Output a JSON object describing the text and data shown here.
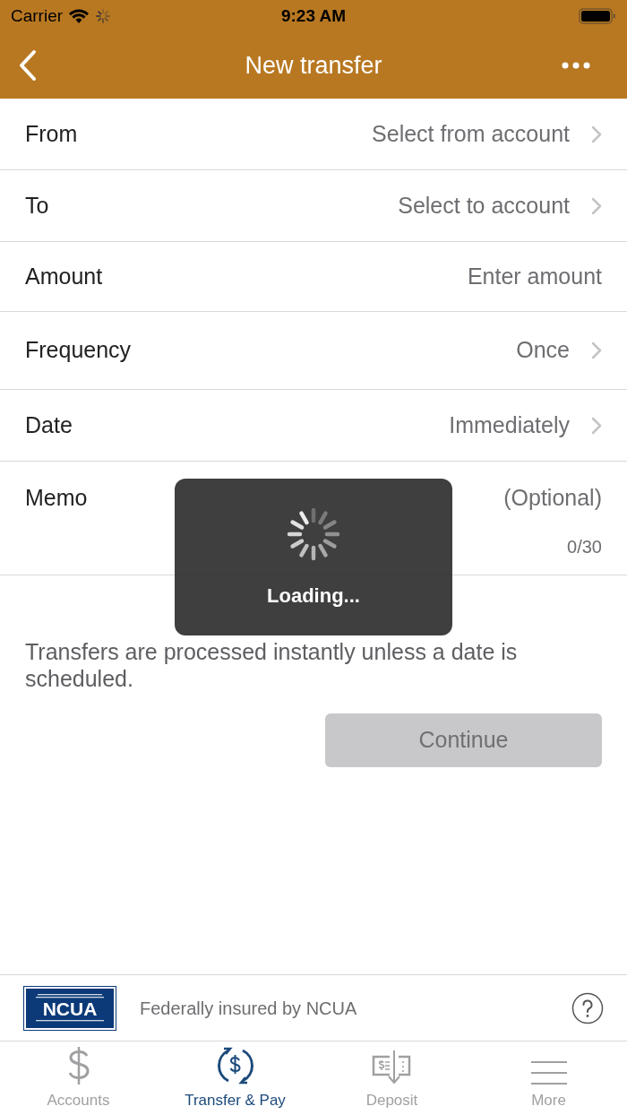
{
  "status_bar": {
    "carrier": "Carrier",
    "time": "9:23 AM"
  },
  "nav": {
    "title": "New transfer"
  },
  "form": [
    {
      "kind": "select",
      "label": "From",
      "value": "Select from account"
    },
    {
      "kind": "select",
      "label": "To",
      "value": "Select to account"
    },
    {
      "kind": "input",
      "label": "Amount",
      "placeholder": "Enter amount"
    },
    {
      "kind": "select",
      "label": "Frequency",
      "value": "Once"
    },
    {
      "kind": "select",
      "label": "Date",
      "value": "Immediately"
    },
    {
      "kind": "memo",
      "label": "Memo",
      "placeholder": "(Optional)",
      "counter": "0/30"
    }
  ],
  "note": "Transfers are processed instantly unless a date is scheduled.",
  "continue_button": {
    "label": "Continue",
    "disabled": true
  },
  "loading": {
    "label": "Loading..."
  },
  "footer": {
    "logo": "NCUA",
    "text": "Federally insured by NCUA"
  },
  "tabs": [
    {
      "kind": "accounts",
      "label": "Accounts",
      "selected": false
    },
    {
      "kind": "transfer",
      "label": "Transfer & Pay",
      "selected": true
    },
    {
      "kind": "deposit",
      "label": "Deposit",
      "selected": false
    },
    {
      "kind": "more",
      "label": "More",
      "selected": false
    }
  ]
}
